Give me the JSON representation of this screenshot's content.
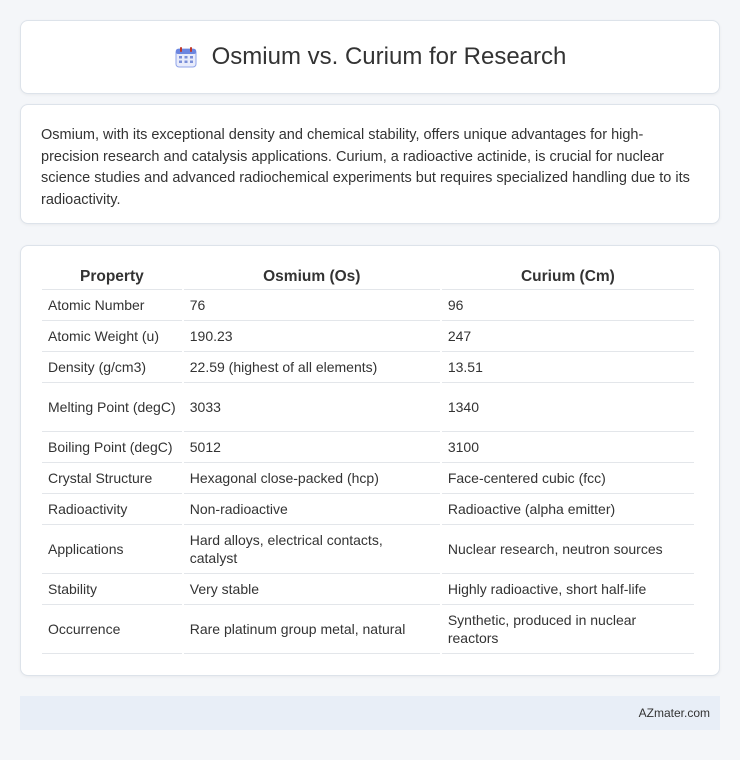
{
  "header": {
    "title": "Osmium vs. Curium for Research",
    "icon": "calendar-icon",
    "accent_color": "#5b7fd6"
  },
  "intro": {
    "text": "Osmium, with its exceptional density and chemical stability, offers unique advantages for high-precision research and catalysis applications. Curium, a radioactive actinide, is crucial for nuclear science studies and advanced radiochemical experiments but requires specialized handling due to its radioactivity."
  },
  "table": {
    "headers": [
      "Property",
      "Osmium (Os)",
      "Curium (Cm)"
    ],
    "rows": [
      [
        "Atomic Number",
        "76",
        "96"
      ],
      [
        "Atomic Weight (u)",
        "190.23",
        "247"
      ],
      [
        "Density (g/cm3)",
        "22.59 (highest of all elements)",
        "13.51"
      ],
      [
        "Melting Point (degC)",
        "3033",
        "1340"
      ],
      [
        "Boiling Point (degC)",
        "5012",
        "3100"
      ],
      [
        "Crystal Structure",
        "Hexagonal close-packed (hcp)",
        "Face-centered cubic (fcc)"
      ],
      [
        "Radioactivity",
        "Non-radioactive",
        "Radioactive (alpha emitter)"
      ],
      [
        "Applications",
        "Hard alloys, electrical contacts, catalyst",
        "Nuclear research, neutron sources"
      ],
      [
        "Stability",
        "Very stable",
        "Highly radioactive, short half-life"
      ],
      [
        "Occurrence",
        "Rare platinum group metal, natural",
        "Synthetic, produced in nuclear reactors"
      ]
    ]
  },
  "footer": {
    "text": "AZmater.com"
  }
}
